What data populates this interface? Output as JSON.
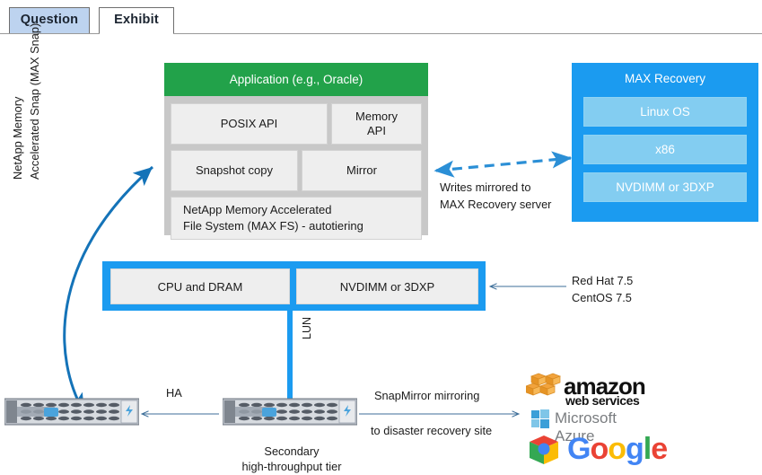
{
  "tabs": [
    {
      "label": "Question",
      "active": false
    },
    {
      "label": "Exhibit",
      "active": true
    }
  ],
  "diagram": {
    "app_stack": {
      "header": "Application (e.g., Oracle)",
      "boxes": [
        {
          "label": "POSIX API"
        },
        {
          "label": "Memory\nAPI"
        },
        {
          "label": "Snapshot copy"
        },
        {
          "label": "Mirror"
        },
        {
          "label": "NetApp Memory Accelerated\nFile System (MAX FS) - autotiering"
        }
      ]
    },
    "max_recovery": {
      "title": "MAX Recovery",
      "boxes": [
        {
          "label": "Linux OS"
        },
        {
          "label": "x86"
        },
        {
          "label": "NVDIMM or 3DXP"
        }
      ]
    },
    "hardware": {
      "boxes": [
        {
          "label": "CPU and DRAM"
        },
        {
          "label": "NVDIMM or 3DXP"
        }
      ]
    },
    "labels": {
      "writes_mirrored": "Writes mirrored to\nMAX Recovery server",
      "os_versions": "Red Hat 7.5\nCentOS 7.5",
      "max_snap": "NetApp Memory\nAccelerated Snap (MAX Snap)",
      "lun": "LUN",
      "ha": "HA",
      "snapmirror_top": "SnapMirror mirroring",
      "snapmirror_bottom": "to disaster recovery site",
      "secondary_tier": "Secondary\nhigh-throughput tier"
    },
    "clouds": [
      {
        "name": "amazon-web-services",
        "line1": "amazon",
        "line2": "web services"
      },
      {
        "name": "microsoft-azure",
        "line1": "Microsoft Azure"
      },
      {
        "name": "google",
        "line1": "Google"
      }
    ],
    "colors": {
      "green_header": "#22a24a",
      "blue_accent": "#1b9bf0",
      "light_blue": "#83cdf1",
      "box_gray": "#eeeeee",
      "stack_gray": "#c8c8c8",
      "tab_active_bg": "#bdd3ef"
    }
  }
}
